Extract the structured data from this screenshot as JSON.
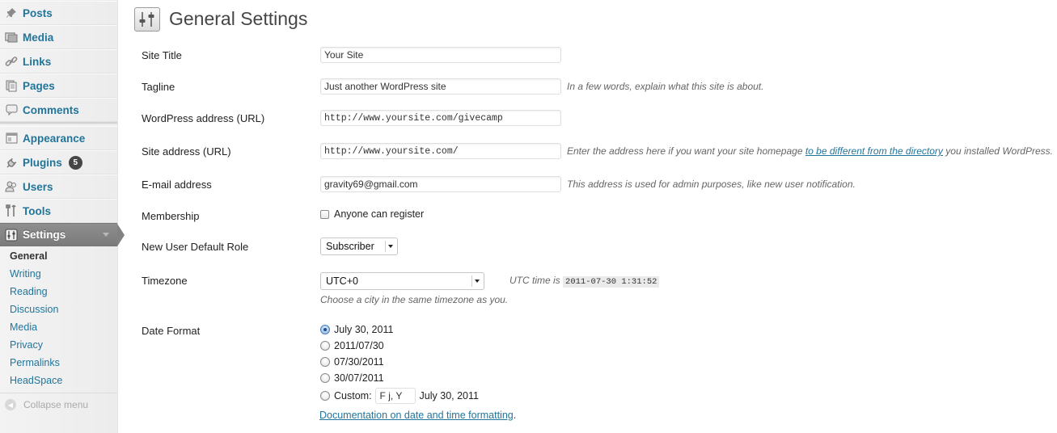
{
  "sidebar": {
    "menu": [
      {
        "label": "Posts",
        "icon": "pushpin-icon"
      },
      {
        "label": "Media",
        "icon": "media-icon"
      },
      {
        "label": "Links",
        "icon": "link-icon"
      },
      {
        "label": "Pages",
        "icon": "pages-icon"
      },
      {
        "label": "Comments",
        "icon": "comment-icon"
      },
      {
        "label": "Appearance",
        "icon": "appearance-icon"
      },
      {
        "label": "Plugins",
        "icon": "plug-icon",
        "badge": "5"
      },
      {
        "label": "Users",
        "icon": "users-icon"
      },
      {
        "label": "Tools",
        "icon": "tools-icon"
      },
      {
        "label": "Settings",
        "icon": "settings-icon"
      }
    ],
    "submenu": [
      "General",
      "Writing",
      "Reading",
      "Discussion",
      "Media",
      "Privacy",
      "Permalinks",
      "HeadSpace"
    ],
    "collapse_label": "Collapse menu"
  },
  "page": {
    "title": "General Settings"
  },
  "form": {
    "site_title": {
      "label": "Site Title",
      "value": "Your Site"
    },
    "tagline": {
      "label": "Tagline",
      "value": "Just another WordPress site",
      "desc": "In a few words, explain what this site is about."
    },
    "wp_address": {
      "label": "WordPress address (URL)",
      "value": "http://www.yoursite.com/givecamp"
    },
    "site_address": {
      "label": "Site address (URL)",
      "value": "http://www.yoursite.com/",
      "desc_before": "Enter the address here if you want your site homepage ",
      "desc_link": "to be different from the directory",
      "desc_after": " you installed WordPress."
    },
    "email": {
      "label": "E-mail address",
      "value": "gravity69@gmail.com",
      "desc": "This address is used for admin purposes, like new user notification."
    },
    "membership": {
      "label": "Membership",
      "checkbox_label": "Anyone can register"
    },
    "default_role": {
      "label": "New User Default Role",
      "selected": "Subscriber"
    },
    "timezone": {
      "label": "Timezone",
      "selected": "UTC+0",
      "utc_prefix": "UTC time is",
      "utc_time": "2011-07-30 1:31:52",
      "desc": "Choose a city in the same timezone as you."
    },
    "date_format": {
      "label": "Date Format",
      "options": [
        "July 30, 2011",
        "2011/07/30",
        "07/30/2011",
        "30/07/2011"
      ],
      "custom_label": "Custom:",
      "custom_value": "F j, Y",
      "custom_preview": "July 30, 2011",
      "doc_link": "Documentation on date and time formatting",
      "doc_suffix": "."
    }
  },
  "colors": {
    "link": "#21759b",
    "settings_active_bg": "#828282",
    "badge_bg": "#464646"
  }
}
